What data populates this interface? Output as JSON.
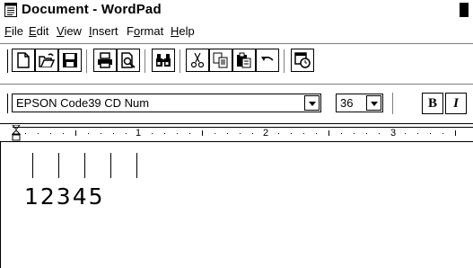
{
  "window": {
    "title": "Document - WordPad",
    "icon": "wordpad-document-icon"
  },
  "menu": {
    "items": [
      {
        "label": "File",
        "accel": "F"
      },
      {
        "label": "Edit",
        "accel": "E"
      },
      {
        "label": "View",
        "accel": "V"
      },
      {
        "label": "Insert",
        "accel": "I"
      },
      {
        "label": "Format",
        "accel": "o"
      },
      {
        "label": "Help",
        "accel": "H"
      }
    ]
  },
  "toolbar": {
    "buttons": [
      "new-icon",
      "open-icon",
      "save-icon",
      "print-icon",
      "print-preview-icon",
      "find-icon",
      "cut-icon",
      "copy-icon",
      "paste-icon",
      "undo-icon",
      "insert-date-icon"
    ]
  },
  "format": {
    "font_name": "EPSON Code39 CD Num",
    "font_size": "36",
    "bold_label": "B",
    "italic_label": "I"
  },
  "ruler": {
    "numbers": [
      "1",
      "2",
      "3"
    ]
  },
  "document": {
    "content": "12345"
  }
}
